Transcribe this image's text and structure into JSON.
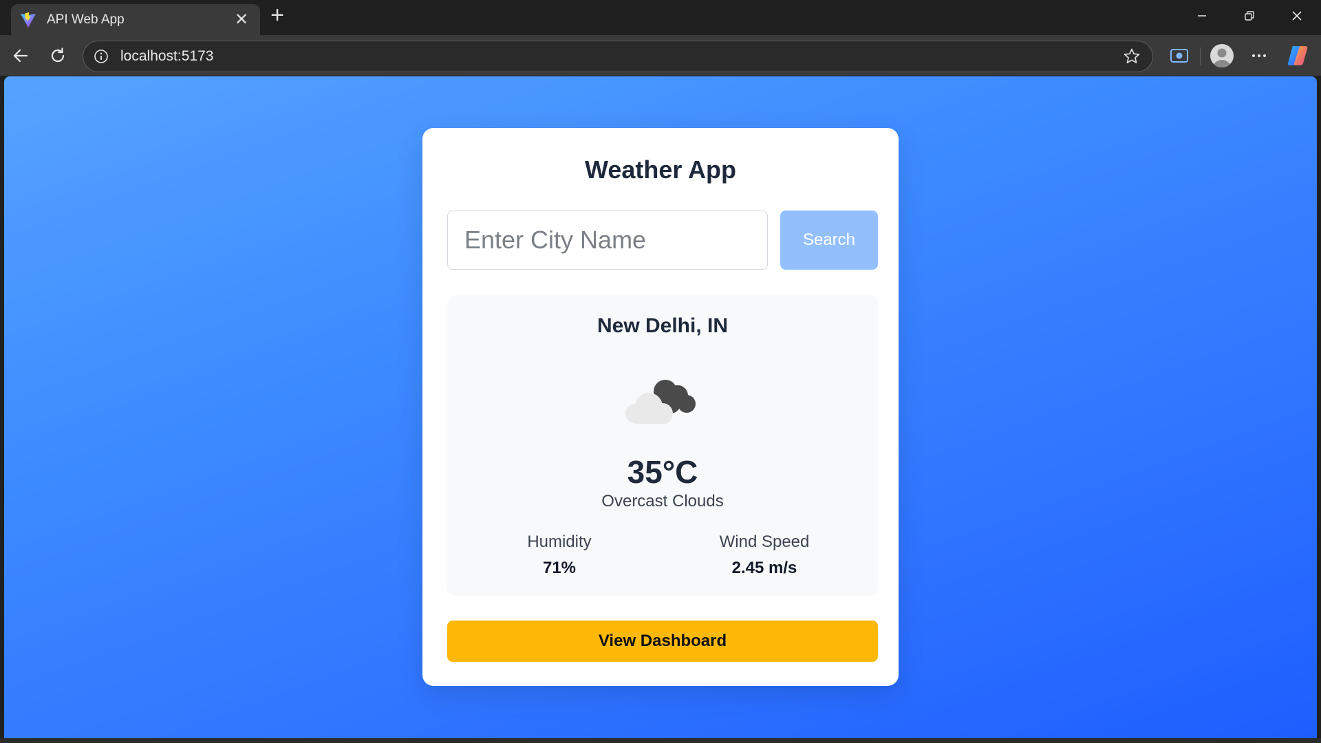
{
  "browser": {
    "tab_title": "API Web App",
    "tab_close": "✕",
    "new_tab": "+",
    "url": "localhost:5173",
    "icons": [
      "vite-favicon",
      "close-icon",
      "plus-icon",
      "minimize-icon",
      "restore-icon",
      "window-close-icon",
      "back-arrow-icon",
      "reload-icon",
      "info-icon",
      "star-icon",
      "screenshot-icon",
      "profile-icon",
      "more-icon",
      "copilot-icon"
    ]
  },
  "app": {
    "title": "Weather App",
    "search": {
      "placeholder": "Enter City Name",
      "value": "",
      "button_label": "Search"
    },
    "weather": {
      "city": "New Delhi, IN",
      "icon": "overcast-clouds-icon",
      "temperature": "35°C",
      "description": "Overcast Clouds",
      "humidity_label": "Humidity",
      "humidity_value": "71%",
      "wind_label": "Wind Speed",
      "wind_value": "2.45 m/s"
    },
    "dashboard_button_label": "View Dashboard"
  },
  "colors": {
    "background_gradient_start": "#55a3ff",
    "background_gradient_end": "#1e5eff",
    "search_button": "#93c0fd",
    "dashboard_button": "#fdb808",
    "card": "#ffffff",
    "weather_box": "#f8f9fa"
  }
}
